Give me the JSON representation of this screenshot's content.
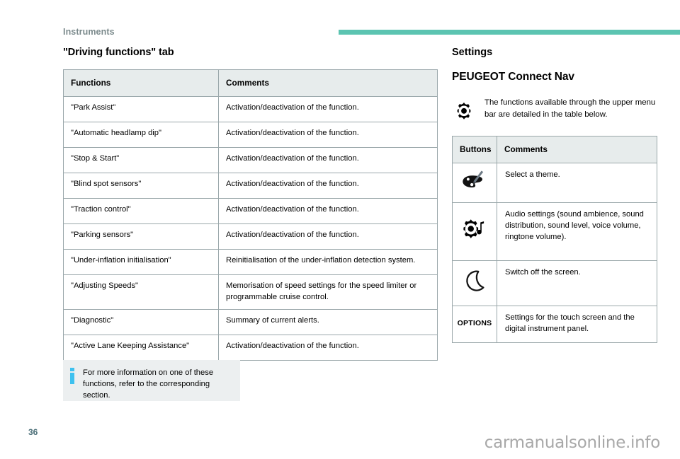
{
  "header": {
    "breadcrumb": "Instruments",
    "rule_color": "#5cc4b1"
  },
  "left": {
    "section_title": "\"Driving functions\" tab",
    "table": {
      "columns": [
        "Functions",
        "Comments"
      ],
      "rows": [
        [
          "\"Park Assist\"",
          "Activation/deactivation of the function."
        ],
        [
          "\"Automatic headlamp dip\"",
          "Activation/deactivation of the function."
        ],
        [
          "\"Stop & Start\"",
          "Activation/deactivation of the function."
        ],
        [
          "\"Blind spot sensors\"",
          "Activation/deactivation of the function."
        ],
        [
          "\"Traction control\"",
          "Activation/deactivation of the function."
        ],
        [
          "\"Parking sensors\"",
          "Activation/deactivation of the function."
        ],
        [
          "\"Under-inflation initialisation\"",
          "Reinitialisation of the under-inflation detection system."
        ],
        [
          "\"Adjusting Speeds\"",
          "Memorisation of speed settings for the speed limiter or programmable cruise control."
        ],
        [
          "\"Diagnostic\"",
          "Summary of current alerts."
        ],
        [
          "\"Active Lane Keeping Assistance\"",
          "Activation/deactivation of the function."
        ]
      ]
    },
    "info_box": {
      "icon": "info-icon",
      "icon_color": "#3ec1ef",
      "text": "For more information on one of these functions, refer to the corresponding section.",
      "background": "#eceff0"
    }
  },
  "right": {
    "settings_title": "Settings",
    "product_title": "PEUGEOT Connect Nav",
    "gear_note": {
      "icon": "gear-icon",
      "text": "The functions available through the upper menu bar are detailed in the table below."
    },
    "table": {
      "columns": [
        "Buttons",
        "Comments"
      ],
      "rows": [
        {
          "icon": "palette-icon",
          "label": "",
          "comment": "Select a theme."
        },
        {
          "icon": "audio-settings-icon",
          "label": "",
          "comment": "Audio settings (sound ambience, sound distribution, sound level, voice volume, ringtone volume)."
        },
        {
          "icon": "moon-icon",
          "label": "",
          "comment": "Switch off the screen."
        },
        {
          "icon": "options-text-button",
          "label": "OPTIONS",
          "comment": "Settings for the touch screen and the digital instrument panel."
        }
      ]
    }
  },
  "footer": {
    "page_number": "36",
    "watermark": "carmanualsonline.info"
  }
}
